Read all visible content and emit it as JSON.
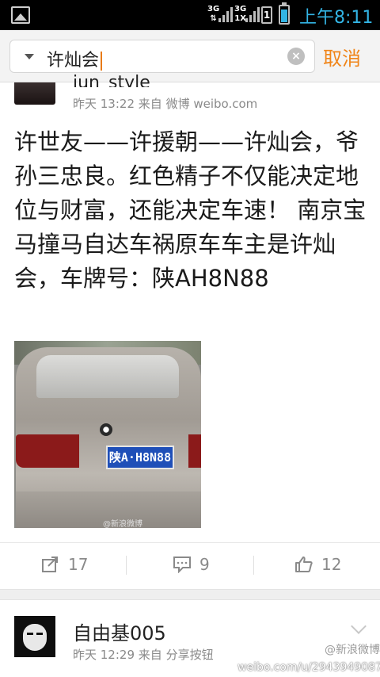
{
  "status_bar": {
    "net1": "3G",
    "net2": "3G",
    "net2_sub": "1X",
    "sim_label": "1",
    "time": "上午8:11",
    "battery_level": 0.85,
    "accent": "#33b5e5"
  },
  "search": {
    "query": "许灿会",
    "cancel_label": "取消",
    "clear_icon": "×",
    "accent": "#f08519"
  },
  "post1": {
    "username": "jun_style",
    "time": "昨天 13:22",
    "source_prefix": "来自",
    "source": "微博 weibo.com",
    "text": "许世友——许援朝——许灿会，爷孙三忠良。红色精子不仅能决定地位与财富，还能决定车速！ 南京宝马撞马自达车祸原车车主是许灿会，车牌号：陕AH8N88",
    "photo_plate": "陕A·H8N88",
    "photo_watermark": "@新浪微博",
    "repost_count": "17",
    "comment_count": "9",
    "like_count": "12"
  },
  "post2": {
    "username": "自由基005",
    "time": "昨天 12:29",
    "source_prefix": "来自",
    "source": "分享按钮",
    "watermark": "weibo.com/u/2943949087",
    "watermark_handle": "@新浪微博"
  }
}
